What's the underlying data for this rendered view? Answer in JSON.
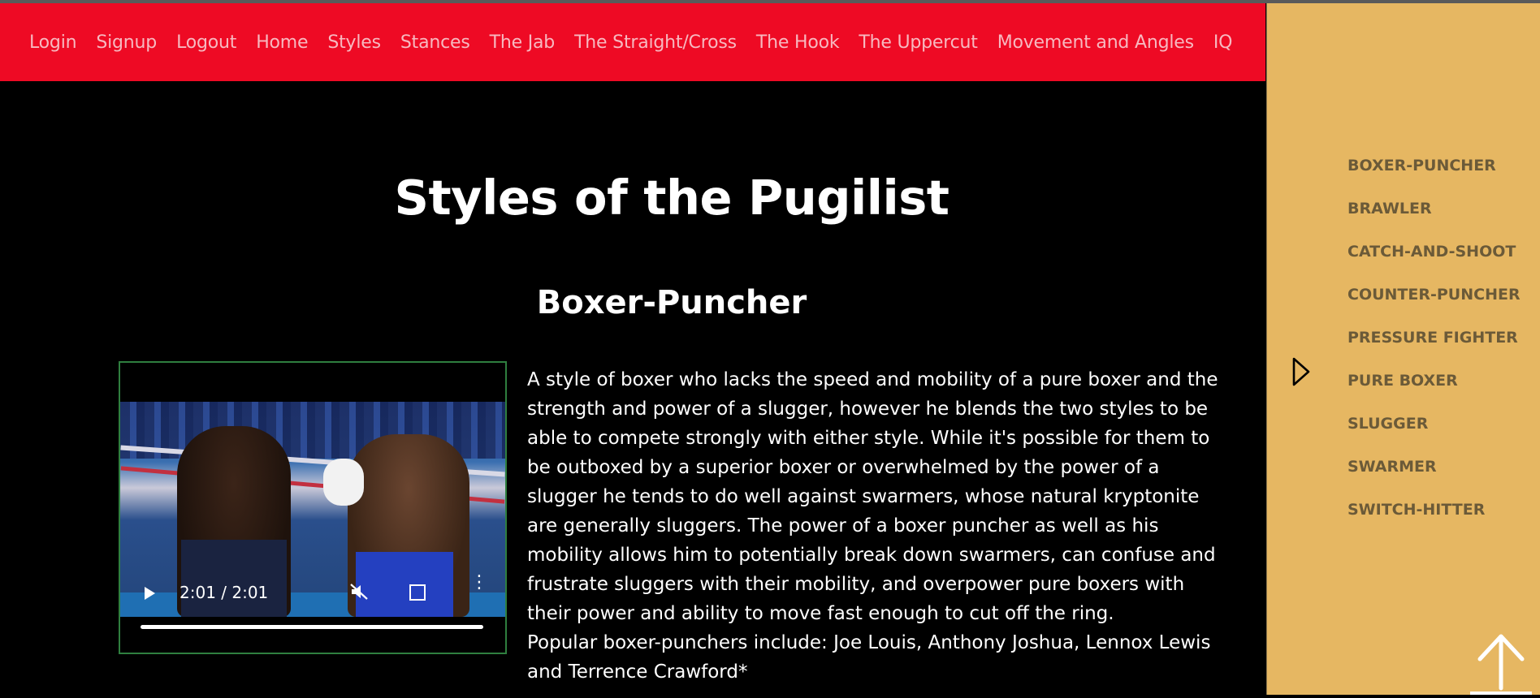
{
  "nav": {
    "items": [
      "Login",
      "Signup",
      "Logout",
      "Home",
      "Styles",
      "Stances",
      "The Jab",
      "The Straight/Cross",
      "The Hook",
      "The Uppercut",
      "Movement and Angles",
      "IQ"
    ]
  },
  "main": {
    "title": "Styles of the Pugilist",
    "section_title": "Boxer-Puncher",
    "video": {
      "time": "2:01 / 2:01",
      "progress": 1.0
    },
    "description": "A style of boxer who lacks the speed and mobility of a pure boxer and the strength and power of a slugger, however he blends the two styles to be able to compete strongly with either style. While it's possible for them to be outboxed by a superior boxer or overwhelmed by the power of a slugger he tends to do well against swarmers, whose natural kryptonite are generally sluggers. The power of a boxer puncher as well as his mobility allows him to potentially break down swarmers, can confuse and frustrate sluggers with their mobility, and overpower pure boxers with their power and ability to move fast enough to cut off the ring.",
    "popular": "Popular boxer-punchers include: Joe Louis, Anthony Joshua, Lennox Lewis and Terrence Crawford*"
  },
  "sidebar": {
    "items": [
      "BOXER-PUNCHER",
      "BRAWLER",
      "CATCH-AND-SHOOT",
      "COUNTER-PUNCHER",
      "PRESSURE FIGHTER",
      "PURE BOXER",
      "SLUGGER",
      "SWARMER",
      "SWITCH-HITTER"
    ],
    "toggle_icon": "chevron-right-outline-icon",
    "up_icon": "arrow-up-icon"
  },
  "colors": {
    "nav_bg": "#ee0a24",
    "nav_text": "#f7b9c0",
    "sidebar_bg": "#e6b762",
    "sidebar_text": "#6b5a38",
    "video_border": "#2f7f3f"
  }
}
